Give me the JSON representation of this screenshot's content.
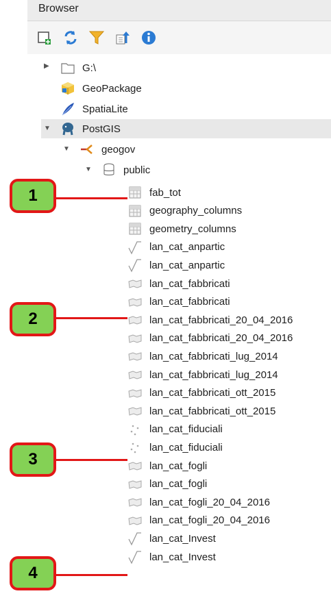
{
  "panel": {
    "title": "Browser"
  },
  "toolbar": [
    {
      "name": "add-layer-icon"
    },
    {
      "name": "refresh-icon"
    },
    {
      "name": "filter-icon"
    },
    {
      "name": "collapse-all-icon"
    },
    {
      "name": "info-icon"
    }
  ],
  "tree": {
    "roots": [
      {
        "label": "G:\\",
        "icon": "folder-icon"
      },
      {
        "label": "GeoPackage",
        "icon": "geopackage-icon"
      },
      {
        "label": "SpatiaLite",
        "icon": "spatialite-icon"
      },
      {
        "label": "PostGIS",
        "icon": "postgis-icon"
      }
    ],
    "connection": {
      "label": "geogov",
      "icon": "connection-icon"
    },
    "schema": {
      "label": "public",
      "icon": "schema-icon"
    },
    "tables": [
      {
        "label": "fab_tot",
        "icon": "table-icon"
      },
      {
        "label": "geography_columns",
        "icon": "table-icon"
      },
      {
        "label": "geometry_columns",
        "icon": "table-icon"
      },
      {
        "label": "lan_cat_anpartic",
        "icon": "line-layer-icon"
      },
      {
        "label": "lan_cat_anpartic",
        "icon": "line-layer-icon"
      },
      {
        "label": "lan_cat_fabbricati",
        "icon": "polygon-layer-icon"
      },
      {
        "label": "lan_cat_fabbricati",
        "icon": "polygon-layer-icon"
      },
      {
        "label": "lan_cat_fabbricati_20_04_2016",
        "icon": "polygon-layer-icon"
      },
      {
        "label": "lan_cat_fabbricati_20_04_2016",
        "icon": "polygon-layer-icon"
      },
      {
        "label": "lan_cat_fabbricati_lug_2014",
        "icon": "polygon-layer-icon"
      },
      {
        "label": "lan_cat_fabbricati_lug_2014",
        "icon": "polygon-layer-icon"
      },
      {
        "label": "lan_cat_fabbricati_ott_2015",
        "icon": "polygon-layer-icon"
      },
      {
        "label": "lan_cat_fabbricati_ott_2015",
        "icon": "polygon-layer-icon"
      },
      {
        "label": "lan_cat_fiduciali",
        "icon": "point-layer-icon"
      },
      {
        "label": "lan_cat_fiduciali",
        "icon": "point-layer-icon"
      },
      {
        "label": "lan_cat_fogli",
        "icon": "polygon-layer-icon"
      },
      {
        "label": "lan_cat_fogli",
        "icon": "polygon-layer-icon"
      },
      {
        "label": "lan_cat_fogli_20_04_2016",
        "icon": "polygon-layer-icon"
      },
      {
        "label": "lan_cat_fogli_20_04_2016",
        "icon": "polygon-layer-icon"
      },
      {
        "label": "lan_cat_Invest",
        "icon": "line-layer-icon"
      },
      {
        "label": "lan_cat_Invest",
        "icon": "line-layer-icon"
      }
    ]
  },
  "callouts": [
    {
      "label": "1",
      "target": "fab_tot"
    },
    {
      "label": "2",
      "target": "lan_cat_fabbricati"
    },
    {
      "label": "3",
      "target": "lan_cat_fiduciali"
    },
    {
      "label": "4",
      "target": "lan_cat_Invest"
    }
  ],
  "colors": {
    "callout_fill": "#84d155",
    "callout_border": "#e21717",
    "postgis_blue": "#336791"
  }
}
